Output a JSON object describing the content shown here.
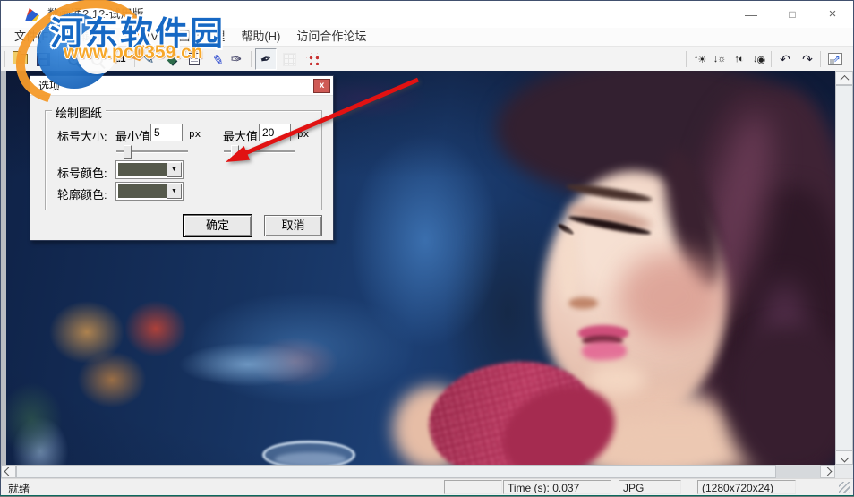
{
  "titlebar": {
    "title": "数画通2.12-试用版",
    "minimize_glyph": "—",
    "maximize_glyph": "□",
    "close_glyph": "×"
  },
  "menu": {
    "items": [
      {
        "label": "文件(F)"
      },
      {
        "label": "编辑(E)"
      },
      {
        "label": "视图(V)"
      },
      {
        "label": "图像处理"
      },
      {
        "label": "帮助(H)"
      },
      {
        "label": "访问合作论坛"
      }
    ]
  },
  "toolbar": {
    "zoom_in_glyph": "+",
    "zoom_out_glyph": "−",
    "one_to_one": "1:1",
    "pen_glyph": "✎",
    "fill_glyph": "◆",
    "picker_glyph": "✐",
    "brush_glyph": "✑",
    "blade_glyph": "✒",
    "up_arrow": "↑",
    "down_arrow": "↓",
    "sun_filled": "☀",
    "sun_outline": "☼",
    "contrast_half": "◐",
    "contrast_dot": "◉",
    "undo_glyph": "↶",
    "redo_glyph": "↷",
    "fit_glyph": "⇗"
  },
  "dialog": {
    "title": "选项",
    "close_glyph": "x",
    "group_title": "绘制图纸",
    "size_label": "标号大小:",
    "min_label": "最小值:",
    "min_value": "5",
    "min_unit": "px",
    "max_label": "最大值:",
    "max_value": "20",
    "max_unit": "px",
    "marker_color_label": "标号颜色:",
    "outline_color_label": "轮廓颜色:",
    "marker_swatch_style": "background:#565a4c",
    "outline_swatch_style": "background:#565a4c",
    "combo_arrow": "▼",
    "ok_label": "确定",
    "cancel_label": "取消"
  },
  "statusbar": {
    "ready": "就绪",
    "time": "Time (s): 0.037",
    "format": "JPG",
    "dimensions": "(1280x720x24)"
  },
  "watermark": {
    "site_name": "河东软件园",
    "site_url": "www.pc0359.cn"
  },
  "colors": {
    "annotation_arrow": "#e11212",
    "color_swatch": "#565a4c",
    "dialog_close": "#cf5a55"
  }
}
